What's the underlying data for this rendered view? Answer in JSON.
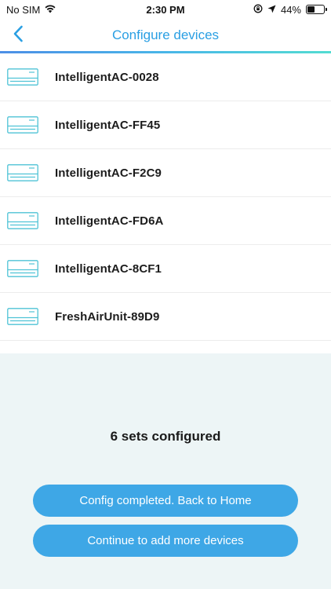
{
  "status_bar": {
    "carrier": "No SIM",
    "time": "2:30 PM",
    "battery_text": "44%",
    "battery_level": 0.44,
    "icons": [
      "wifi-icon",
      "orientation-lock-icon",
      "location-arrow-icon",
      "battery-icon"
    ]
  },
  "nav": {
    "title": "Configure devices",
    "back_icon": "chevron-left-icon"
  },
  "devices": [
    {
      "name": "IntelligentAC-0028",
      "icon": "air-conditioner-icon"
    },
    {
      "name": "IntelligentAC-FF45",
      "icon": "air-conditioner-icon"
    },
    {
      "name": "IntelligentAC-F2C9",
      "icon": "air-conditioner-icon"
    },
    {
      "name": "IntelligentAC-FD6A",
      "icon": "air-conditioner-icon"
    },
    {
      "name": "IntelligentAC-8CF1",
      "icon": "air-conditioner-icon"
    },
    {
      "name": "FreshAirUnit-89D9",
      "icon": "air-conditioner-icon"
    }
  ],
  "summary": {
    "text": "6 sets configured"
  },
  "buttons": {
    "back_home": "Config completed. Back to Home",
    "add_more": "Continue to add more devices"
  },
  "colors": {
    "accent": "#2a9fe3",
    "button": "#3ea7e6",
    "panel_bg": "#edf5f6",
    "icon": "#4fc3d6"
  }
}
